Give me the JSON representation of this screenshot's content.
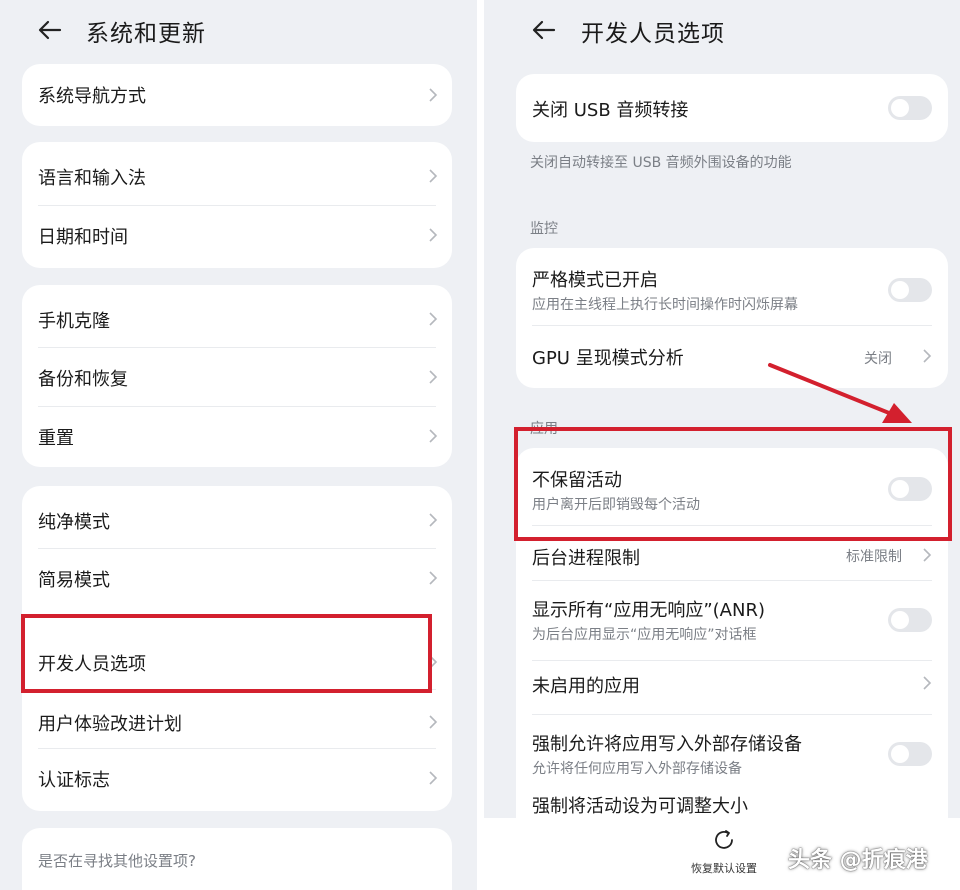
{
  "left": {
    "header": {
      "title": "系统和更新"
    },
    "items": {
      "nav_mode": "系统导航方式",
      "language": "语言和输入法",
      "datetime": "日期和时间",
      "clone": "手机克隆",
      "backup": "备份和恢复",
      "reset": "重置",
      "pure_mode": "纯净模式",
      "simple_mode": "简易模式",
      "developer": "开发人员选项",
      "ux_program": "用户体验改进计划",
      "certification": "认证标志"
    },
    "search_prompt": "是否在寻找其他设置项?"
  },
  "right": {
    "header": {
      "title": "开发人员选项"
    },
    "usb_audio": {
      "label": "关闭 USB 音频转接",
      "description": "关闭自动转接至 USB 音频外围设备的功能"
    },
    "monitor_section": "监控",
    "strict_mode": {
      "label": "严格模式已开启",
      "sub": "应用在主线程上执行长时间操作时闪烁屏幕"
    },
    "gpu_profile": {
      "label": "GPU 呈现模式分析",
      "value": "关闭"
    },
    "apps_section": "应用",
    "dont_keep": {
      "label": "不保留活动",
      "sub": "用户离开后即销毁每个活动"
    },
    "bg_limit": {
      "label": "后台进程限制",
      "value": "标准限制"
    },
    "anr": {
      "label": "显示所有“应用无响应”(ANR)",
      "sub": "为后台应用显示“应用无响应”对话框"
    },
    "inactive_apps": {
      "label": "未启用的应用"
    },
    "force_external": {
      "label": "强制允许将应用写入外部存储设备",
      "sub": "允许将任何应用写入外部存储设备"
    },
    "force_resizable": {
      "label": "强制将活动设为可调整大小"
    },
    "restore_default": "恢复默认设置"
  },
  "watermark": "头条 @折痕港",
  "colors": {
    "highlight": "#d3202e",
    "background": "#eef0f4",
    "card": "#ffffff"
  },
  "icons": [
    "back-arrow-icon",
    "chevron-right-icon",
    "restore-icon"
  ]
}
